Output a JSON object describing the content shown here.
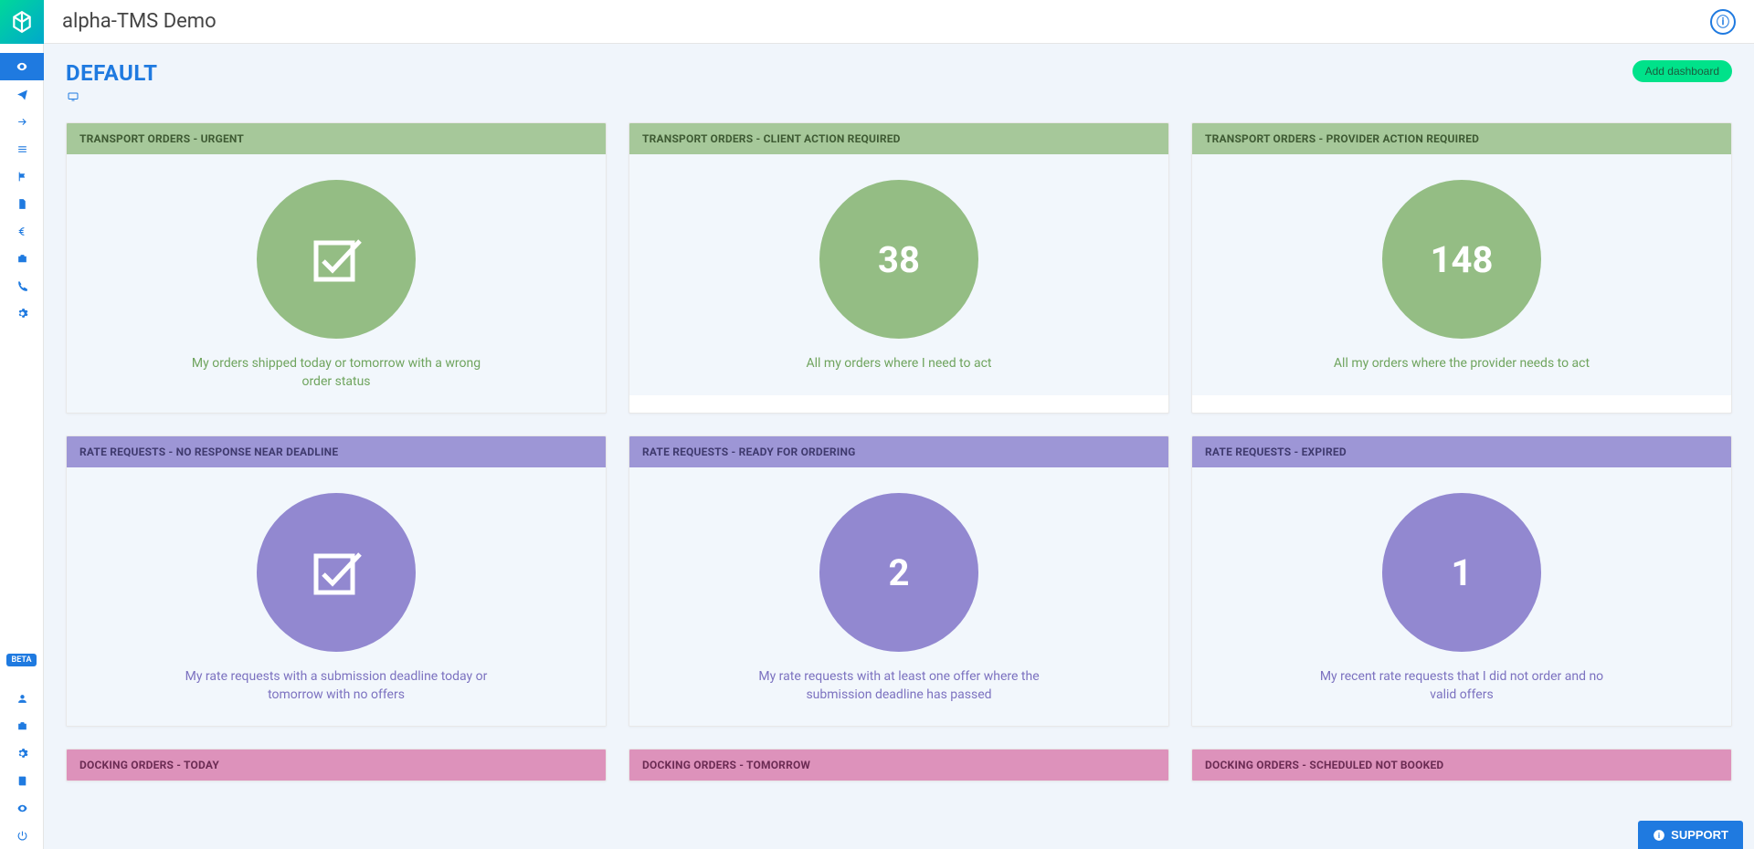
{
  "app": {
    "title": "alpha-TMS Demo"
  },
  "page": {
    "title": "DEFAULT"
  },
  "buttons": {
    "add_dashboard": "Add dashboard",
    "support": "SUPPORT"
  },
  "sidebar": {
    "beta_label": "BETA"
  },
  "cards": [
    {
      "title": "TRANSPORT ORDERS - URGENT",
      "value": "",
      "desc": "My orders shipped today or tomorrow with a wrong order status",
      "theme": "green",
      "icon": "check"
    },
    {
      "title": "TRANSPORT ORDERS - CLIENT ACTION REQUIRED",
      "value": "38",
      "desc": "All my orders where I need to act",
      "theme": "green",
      "icon": ""
    },
    {
      "title": "TRANSPORT ORDERS - PROVIDER ACTION REQUIRED",
      "value": "148",
      "desc": "All my orders where the provider needs to act",
      "theme": "green",
      "icon": ""
    },
    {
      "title": "RATE REQUESTS - NO RESPONSE NEAR DEADLINE",
      "value": "",
      "desc": "My rate requests with a submission deadline today or tomorrow with no offers",
      "theme": "purple",
      "icon": "check"
    },
    {
      "title": "RATE REQUESTS - READY FOR ORDERING",
      "value": "2",
      "desc": "My rate requests with at least one offer where the submission deadline has passed",
      "theme": "purple",
      "icon": ""
    },
    {
      "title": "RATE REQUESTS - EXPIRED",
      "value": "1",
      "desc": "My recent rate requests that I did not order and no valid offers",
      "theme": "purple",
      "icon": ""
    },
    {
      "title": "DOCKING ORDERS - TODAY",
      "value": "",
      "desc": "",
      "theme": "pink",
      "icon": ""
    },
    {
      "title": "DOCKING ORDERS - TOMORROW",
      "value": "",
      "desc": "",
      "theme": "pink",
      "icon": ""
    },
    {
      "title": "DOCKING ORDERS - SCHEDULED NOT BOOKED",
      "value": "",
      "desc": "",
      "theme": "pink",
      "icon": ""
    }
  ]
}
